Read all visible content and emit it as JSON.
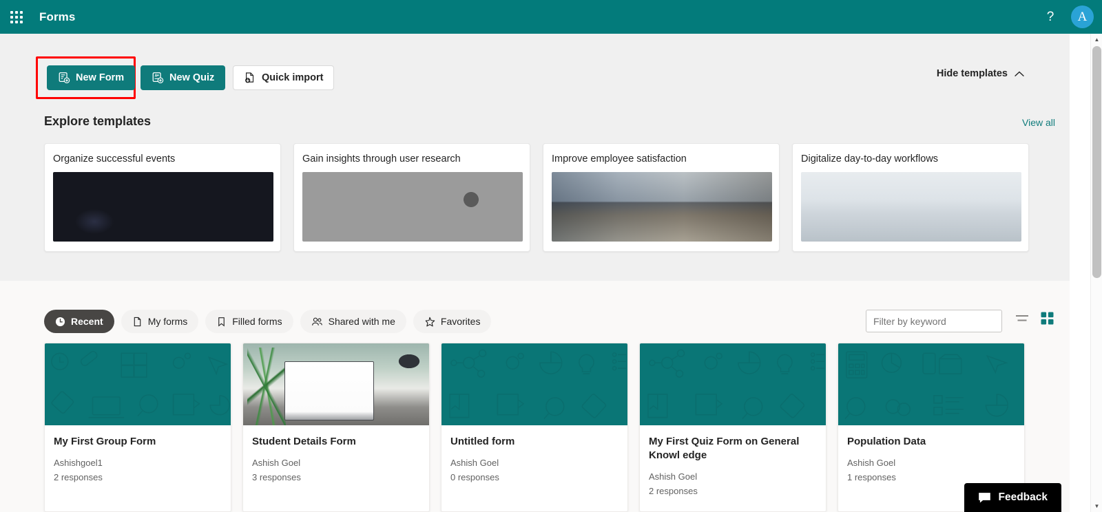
{
  "suitebar": {
    "waffle_label": "app-launcher",
    "title": "Forms",
    "help_label": "?",
    "avatar_initial": "A",
    "background": "#037b7b"
  },
  "toolbar": {
    "new_form_label": "New Form",
    "new_quiz_label": "New Quiz",
    "quick_import_label": "Quick import",
    "hide_templates_label": "Hide templates",
    "highlight_color": "#ff0000",
    "highlighted_target": "New Form"
  },
  "templates": {
    "heading": "Explore templates",
    "view_all_label": "View all",
    "cards": [
      {
        "title": "Organize successful events",
        "image": "auditorium-audience-photo"
      },
      {
        "title": "Gain insights through user research",
        "image": "machine-parts-grayscale-photo"
      },
      {
        "title": "Improve employee satisfaction",
        "image": "office-workers-desk-photo"
      },
      {
        "title": "Digitalize day-to-day workflows",
        "image": "warehouse-interior-photo"
      }
    ]
  },
  "filters": {
    "tabs": [
      {
        "label": "Recent",
        "icon": "clock-icon",
        "active": true
      },
      {
        "label": "My forms",
        "icon": "document-icon",
        "active": false
      },
      {
        "label": "Filled forms",
        "icon": "bookmark-icon",
        "active": false
      },
      {
        "label": "Shared with me",
        "icon": "people-icon",
        "active": false
      },
      {
        "label": "Favorites",
        "icon": "star-icon",
        "active": false
      }
    ],
    "search_placeholder": "Filter by keyword",
    "search_value": "",
    "list_view_icon": "list-view-icon",
    "grid_view_icon": "grid-view-icon",
    "active_view": "grid",
    "active_view_color": "#0f7b7b"
  },
  "forms": [
    {
      "title": "My First Group Form",
      "owner": "Ashishgoel1",
      "responses": "2 responses",
      "thumb": "teal-pattern"
    },
    {
      "title": "Student Details Form",
      "owner": "Ashish Goel",
      "responses": "3 responses",
      "thumb": "laptop-desk-photo"
    },
    {
      "title": "Untitled form",
      "owner": "Ashish Goel",
      "responses": "0 responses",
      "thumb": "teal-pattern"
    },
    {
      "title": "My First Quiz Form on General Knowl edge",
      "owner": "Ashish Goel",
      "responses": "2 responses",
      "thumb": "teal-pattern"
    },
    {
      "title": "Population Data",
      "owner": "Ashish Goel",
      "responses": "1 responses",
      "thumb": "teal-pattern"
    }
  ],
  "feedback": {
    "label": "Feedback",
    "icon": "chat-icon"
  },
  "scrollbar": {
    "up_arrow": "▲",
    "down_arrow": "▼"
  }
}
